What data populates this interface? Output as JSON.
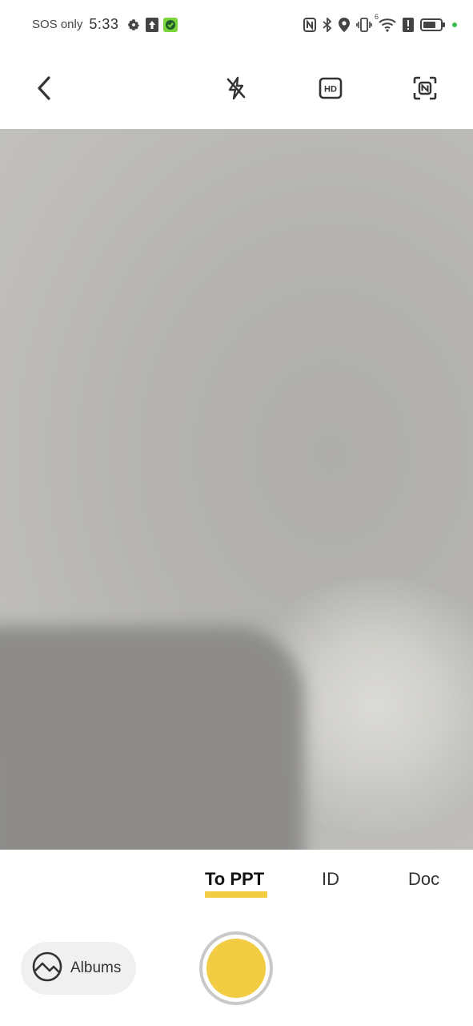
{
  "status_bar": {
    "carrier": "SOS only",
    "time": "5:33",
    "network_type": "6"
  },
  "top_bar": {
    "icons": [
      "back-arrow-icon",
      "flash-off-icon",
      "hd-icon",
      "auto-capture-icon"
    ]
  },
  "modes": {
    "items": [
      "To PPT",
      "ID",
      "Doc"
    ],
    "active": "To PPT"
  },
  "bottom": {
    "albums_label": "Albums"
  },
  "colors": {
    "accent": "#f2cc42",
    "status_green": "#3dbb4e"
  }
}
